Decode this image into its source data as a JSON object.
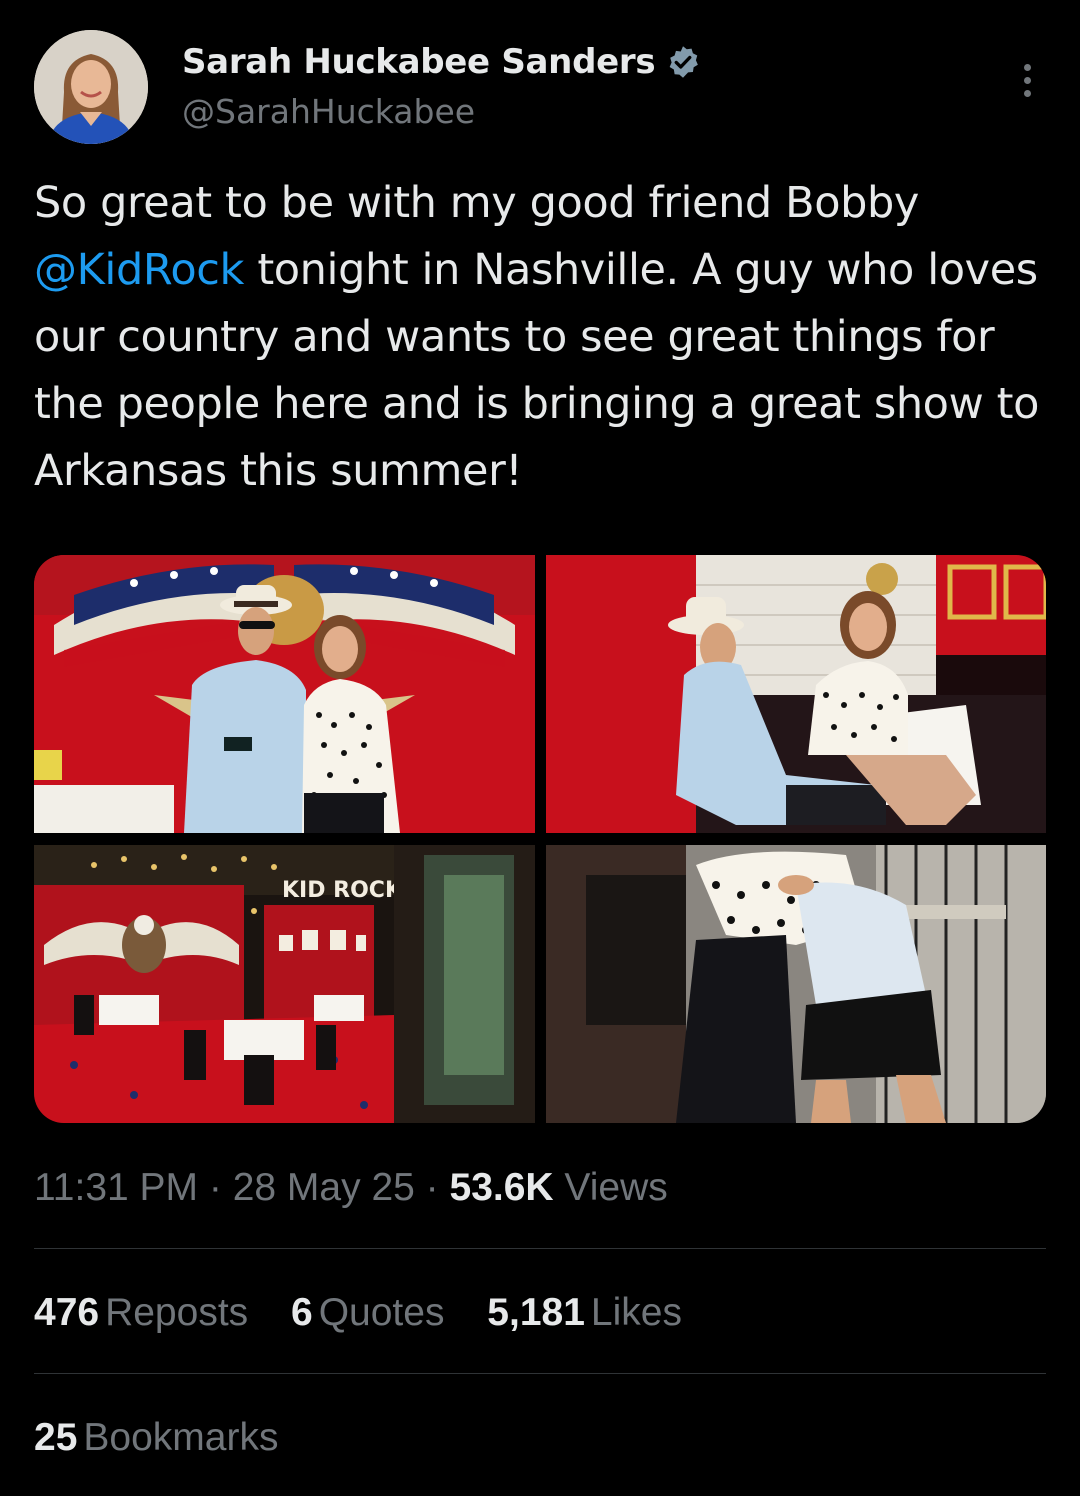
{
  "author": {
    "display_name": "Sarah Huckabee Sanders",
    "handle": "@SarahHuckabee",
    "verified": true,
    "avatar_icon": "profile-photo"
  },
  "tweet": {
    "text_before": "So great to be with my good friend Bobby ",
    "mention": "@KidRock",
    "text_after": " tonight in Nashville. A guy who loves our country and wants to see great things for the people here and is bringing a great show to Arkansas this summer!"
  },
  "media": {
    "count": 4,
    "sign_text": "KID ROCK'S"
  },
  "meta": {
    "time": "11:31 PM",
    "sep1": " · ",
    "date": "28 May 25",
    "sep2": " · ",
    "views_count": "53.6K",
    "views_label": " Views"
  },
  "stats": {
    "reposts_count": "476",
    "reposts_label": "Reposts",
    "quotes_count": "6",
    "quotes_label": "Quotes",
    "likes_count": "5,181",
    "likes_label": "Likes",
    "bookmarks_count": "25",
    "bookmarks_label": "Bookmarks"
  },
  "colors": {
    "background": "#000000",
    "text": "#e7e9ea",
    "muted": "#71767b",
    "link": "#1d9bf0",
    "divider": "#2f3336",
    "verified_badge": "#829aab"
  }
}
